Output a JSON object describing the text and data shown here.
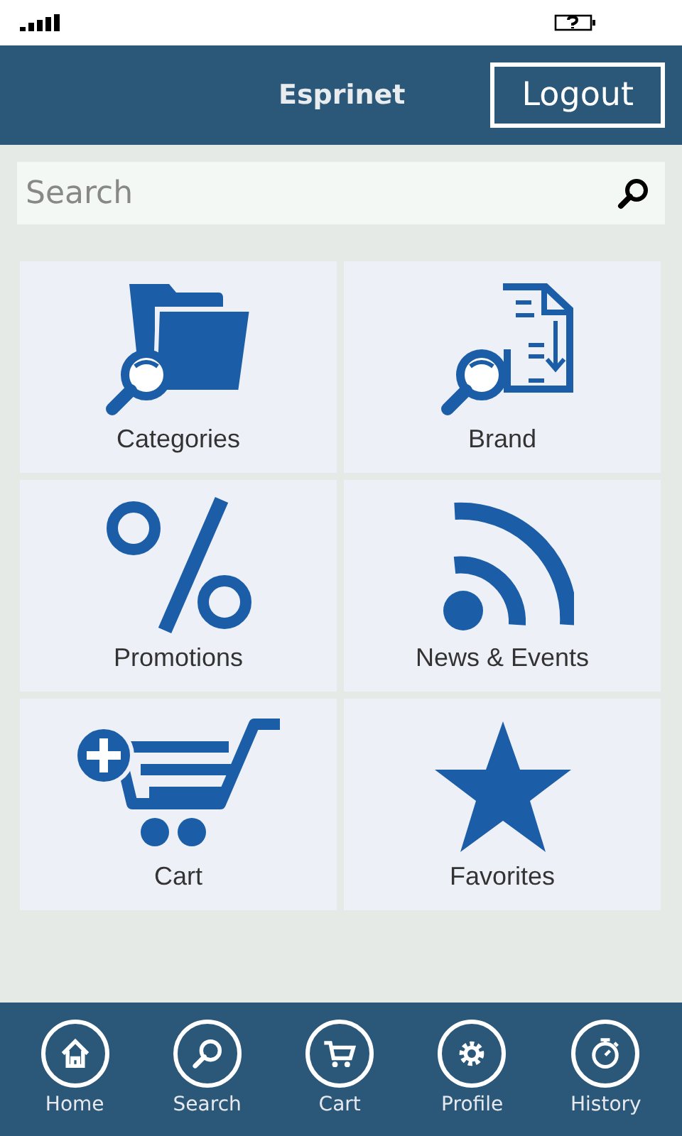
{
  "header": {
    "title": "Esprinet",
    "logout": "Logout"
  },
  "search": {
    "placeholder": "Search"
  },
  "tiles": [
    {
      "label": "Categories"
    },
    {
      "label": "Brand"
    },
    {
      "label": "Promotions"
    },
    {
      "label": "News & Events"
    },
    {
      "label": "Cart"
    },
    {
      "label": "Favorites"
    }
  ],
  "nav": [
    {
      "label": "Home"
    },
    {
      "label": "Search"
    },
    {
      "label": "Cart"
    },
    {
      "label": "Profile"
    },
    {
      "label": "History"
    }
  ]
}
